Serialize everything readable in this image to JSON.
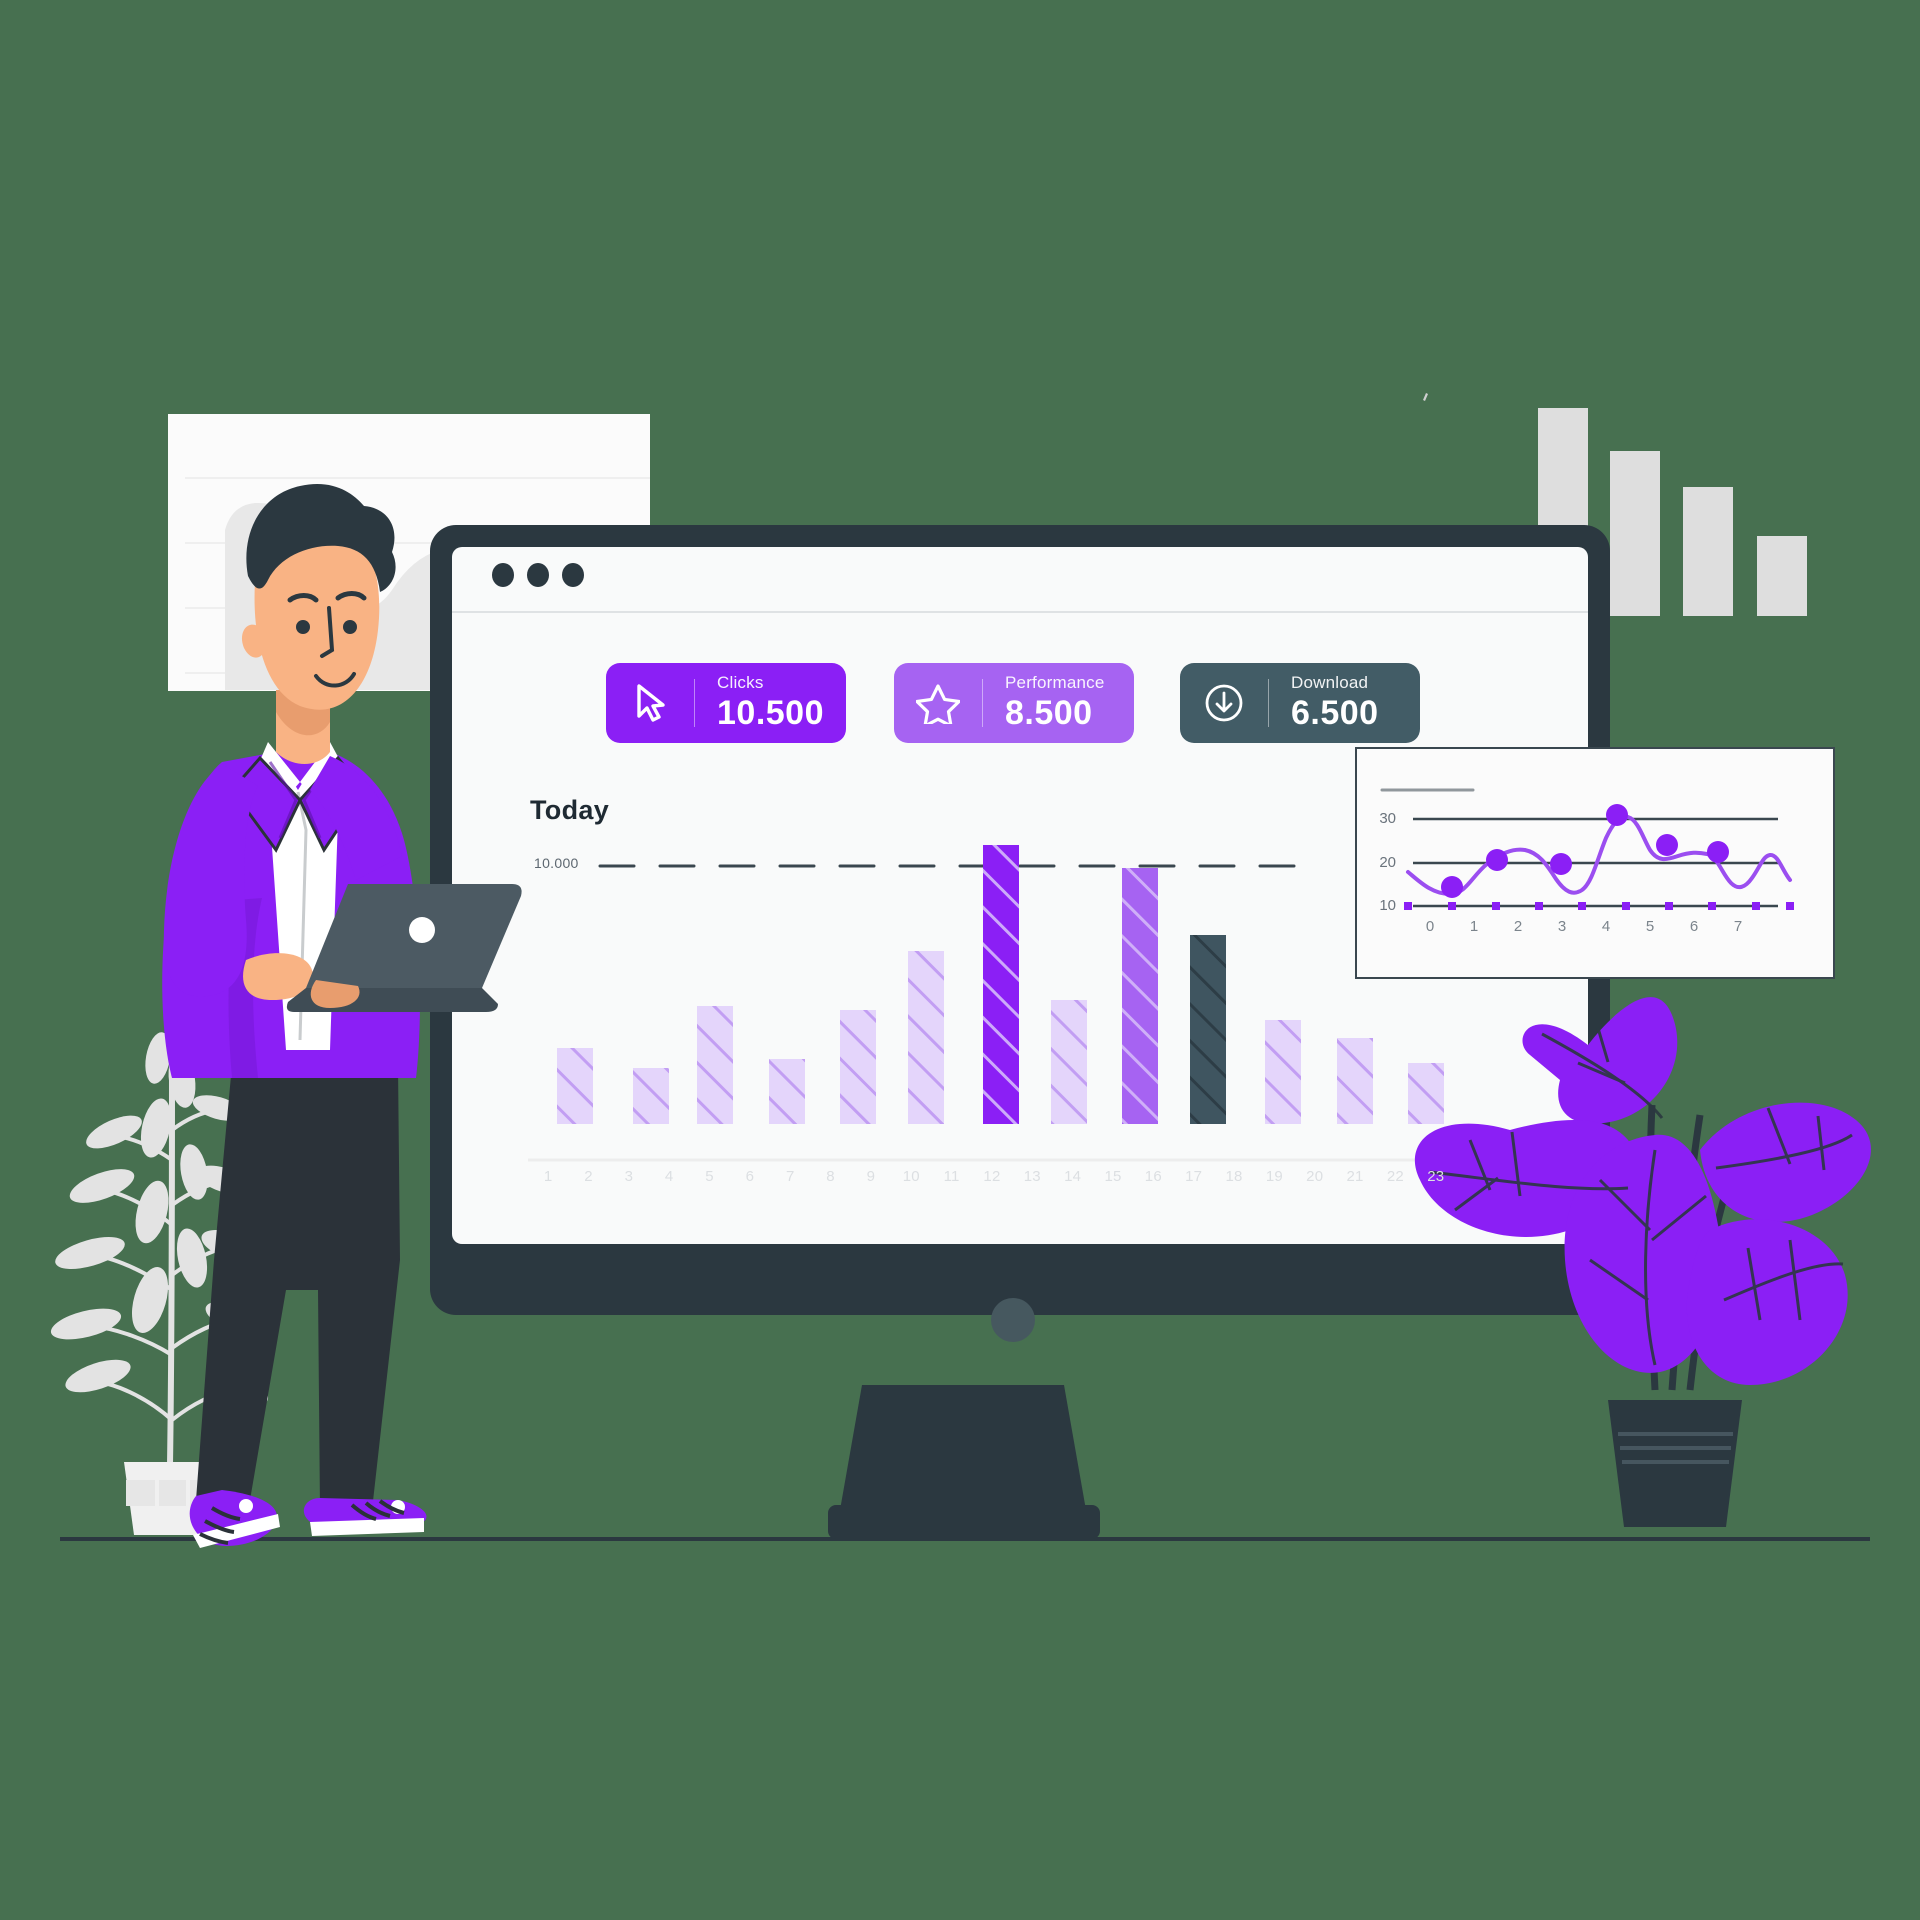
{
  "scene": {
    "background_color": "#477050",
    "ground_line_color": "#2b3840",
    "monitor_body_color": "#2b3840",
    "screen_color": "#f9fafa",
    "accent_purple": "#8B1FF5",
    "accent_purple_light": "#A663F2",
    "accent_purple_pale": "#E4D5FB",
    "slate": "#425C66"
  },
  "window": {
    "dots": [
      "dot-1",
      "dot-2",
      "dot-3"
    ],
    "dot_color": "#2b3840"
  },
  "stats": [
    {
      "id": "clicks",
      "icon": "cursor-icon",
      "label": "Clicks",
      "value": "10.500",
      "bg": "#8B1FF5"
    },
    {
      "id": "performance",
      "icon": "star-icon",
      "label": "Performance",
      "value": "8.500",
      "bg": "#A663F2"
    },
    {
      "id": "download",
      "icon": "download-circle-icon",
      "label": "Download",
      "value": "6.500",
      "bg": "#425C66"
    }
  ],
  "main_chart": {
    "title": "Today",
    "threshold_label": "10.000"
  },
  "chart_data": [
    {
      "id": "today-bar-chart",
      "type": "bar",
      "title": "Today",
      "xlabel": "",
      "ylabel": "",
      "ylim": [
        0,
        12000
      ],
      "grid": false,
      "threshold": 10000,
      "threshold_label": "10.000",
      "threshold_style": "dashed",
      "categories": [
        "1",
        "2",
        "3",
        "4",
        "5",
        "6",
        "7",
        "8",
        "9",
        "10",
        "11",
        "12",
        "13",
        "14",
        "15",
        "16",
        "17",
        "18",
        "19",
        "20",
        "21",
        "22",
        "23"
      ],
      "values": [
        0,
        2600,
        0,
        1900,
        4000,
        0,
        2200,
        0,
        3900,
        5900,
        0,
        11200,
        0,
        4300,
        0,
        9800,
        7100,
        0,
        3500,
        0,
        2800,
        0,
        2000
      ],
      "bar_colors": [
        null,
        "#E4D5FB",
        null,
        "#E4D5FB",
        "#E4D5FB",
        null,
        "#E4D5FB",
        null,
        "#E4D5FB",
        "#E4D5FB",
        null,
        "#8B1FF5",
        null,
        "#E4D5FB",
        null,
        "#A663F2",
        "#425C66",
        null,
        "#E4D5FB",
        null,
        "#E4D5FB",
        null,
        "#E4D5FB"
      ],
      "bar_pattern": "diagonal-stripes",
      "tick_labels": [
        "1",
        "2",
        "3",
        "4",
        "5",
        "6",
        "7",
        "8",
        "9",
        "10",
        "11",
        "12",
        "13",
        "14",
        "15",
        "16",
        "17",
        "18",
        "19",
        "20",
        "21",
        "22",
        "23"
      ]
    },
    {
      "id": "mini-line-chart",
      "type": "line",
      "title": "",
      "xlabel": "",
      "ylabel": "",
      "x": [
        0,
        1,
        2,
        3,
        4,
        5,
        6,
        7
      ],
      "values": [
        17,
        14,
        20.5,
        20,
        31,
        24,
        22,
        14
      ],
      "ylim": [
        10,
        34
      ],
      "xlim": [
        0,
        7
      ],
      "ytick_labels": [
        "30",
        "20",
        "10"
      ],
      "yticks": [
        30,
        20,
        10
      ],
      "xtick_labels": [
        "0",
        "1",
        "2",
        "3",
        "4",
        "5",
        "6",
        "7"
      ],
      "line_color": "#8B1FF5",
      "marker_color": "#8B1FF5",
      "markers_at_x": [
        1,
        2,
        3,
        4,
        5,
        6
      ],
      "grid": true,
      "legend": null
    },
    {
      "id": "backdrop-area-chart",
      "type": "area",
      "title": "",
      "values": [
        8,
        9,
        9,
        6,
        5,
        6.5,
        6,
        3,
        1
      ],
      "color": "#e8e8e8",
      "grid": true,
      "gridline_count": 4
    },
    {
      "id": "decor-bar-chart",
      "type": "bar",
      "categories": [
        "1",
        "2",
        "3",
        "4"
      ],
      "values": [
        4,
        3.2,
        2.5,
        1.3
      ],
      "color": "#dedede",
      "title": "",
      "grid": false
    }
  ],
  "character": {
    "name": "businessman-with-laptop",
    "jacket_color": "#8B1FF5",
    "shirt_color": "#ffffff",
    "pants_color": "#2b3239",
    "hair_color": "#2b3840",
    "skin_color": "#f9b384",
    "shoe_color": "#8B1FF5",
    "laptop_color": "#4c5a63"
  },
  "plants": {
    "left": {
      "name": "gray-leafy-plant",
      "leaf_color": "#e3e3e3",
      "pot_color": "#f0f0f0"
    },
    "right": {
      "name": "purple-leafy-plant",
      "leaf_color": "#8B1FF5",
      "pot_color": "#425C66"
    }
  }
}
